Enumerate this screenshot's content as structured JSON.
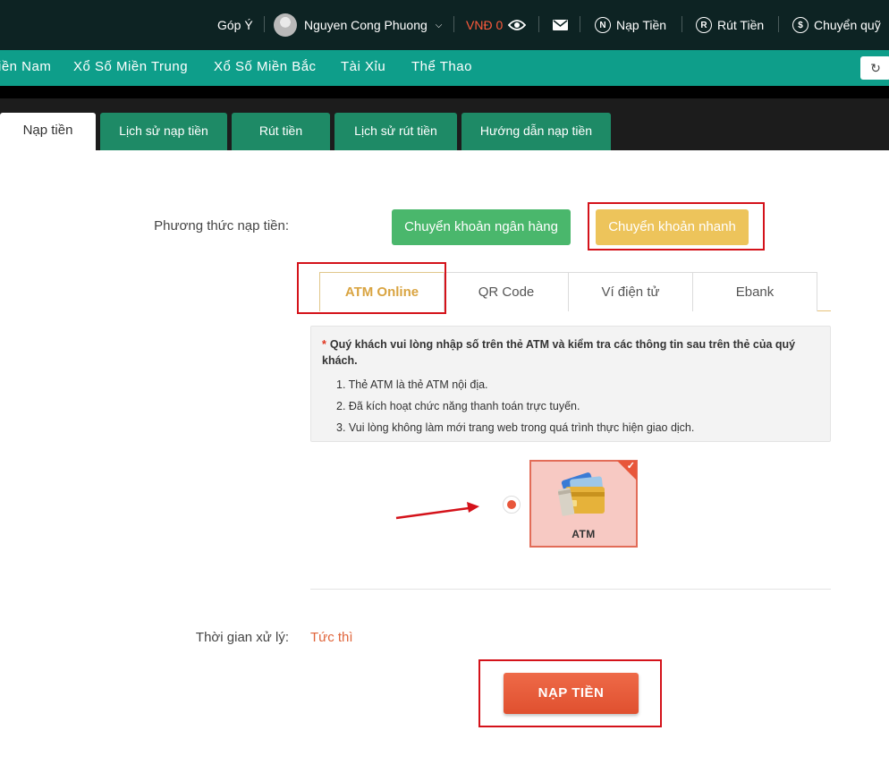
{
  "topbar": {
    "feedback": "Góp Ý",
    "username": "Nguyen Cong Phuong",
    "balance": "VNĐ 0",
    "deposit_icon_letter": "N",
    "deposit": "Nạp Tiền",
    "withdraw_icon_letter": "R",
    "withdraw": "Rút Tiền",
    "transfer_icon_letter": "$",
    "transfer": "Chuyển quỹ"
  },
  "nav": {
    "items": [
      "iền Nam",
      "Xổ Số Miền Trung",
      "Xổ Số Miền Bắc",
      "Tài Xỉu",
      "Thể Thao"
    ],
    "refresh_glyph": "↻"
  },
  "tabs": [
    "Nạp tiền",
    "Lịch sử nạp tiền",
    "Rút tiền",
    "Lịch sử rút tiền",
    "Hướng dẫn nạp tiền"
  ],
  "method": {
    "label": "Phương thức nạp tiền:",
    "options": [
      "Chuyển khoản ngân hàng",
      "Chuyển khoản nhanh"
    ]
  },
  "sub_tabs": [
    "ATM Online",
    "QR Code",
    "Ví điện tử",
    "Ebank"
  ],
  "notice": {
    "star": "*",
    "head": "Quý khách vui lòng nhập số trên thẻ ATM và kiểm tra các thông tin sau trên thẻ của quý khách.",
    "items": [
      "1. Thẻ ATM là thẻ ATM nội địa.",
      "2. Đã kích hoạt chức năng thanh toán trực tuyến.",
      "3. Vui lòng không làm mới trang web trong quá trình thực hiện giao dịch."
    ]
  },
  "payment_option": {
    "label": "ATM",
    "check": "✓"
  },
  "processing": {
    "label": "Thời gian xử lý:",
    "value": "Tức thì"
  },
  "submit": "NẠP TIỀN",
  "colors": {
    "topbar": "#0d2323",
    "navbar": "#0e9e8a",
    "tab_green": "#1e8a66",
    "accent_orange": "#e8563a",
    "annotation_red": "#d4121a"
  }
}
